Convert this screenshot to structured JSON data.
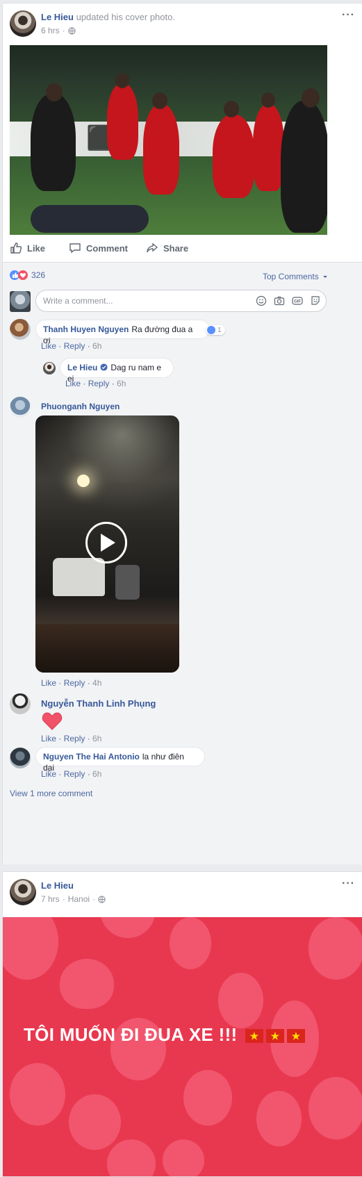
{
  "post1": {
    "author": "Le Hieu",
    "action_text": "updated his cover photo.",
    "time": "6 hrs",
    "privacy_icon": "globe-icon",
    "more_icon": "ellipsis-icon",
    "actions": {
      "like": "Like",
      "comment": "Comment",
      "share": "Share"
    },
    "reactions_count": "326",
    "sort_label": "Top Comments",
    "composer_placeholder": "Write a comment...",
    "composer_icons": [
      "emoji-icon",
      "camera-icon",
      "gif-icon",
      "sticker-icon"
    ],
    "comments": [
      {
        "author": "Thanh Huyen Nguyen",
        "text": "Ra đường đua a ơi",
        "like": "Like",
        "reply": "Reply",
        "time": "6h",
        "reaction_count": "1",
        "reply_item": {
          "author": "Le Hieu",
          "verified_icon": "verified-check-icon",
          "text": "Dag ru nam e ei",
          "like": "Like",
          "reply": "Reply",
          "time": "6h"
        }
      },
      {
        "author": "Phuonganh Nguyen",
        "like": "Like",
        "reply": "Reply",
        "time": "4h"
      },
      {
        "author": "Nguyễn Thanh Linh Phụng",
        "sticker": "heart-icon",
        "like": "Like",
        "reply": "Reply",
        "time": "6h"
      },
      {
        "author": "Nguyen The Hai Antonio",
        "text": "la như điên dại",
        "like": "Like",
        "reply": "Reply",
        "time": "6h"
      }
    ],
    "view_more": "View 1 more comment"
  },
  "post2": {
    "author": "Le Hieu",
    "time": "7 hrs",
    "location": "Hanoi",
    "banner_text": "TÔI MUỐN ĐI ĐUA XE !!!",
    "flags_count": 3,
    "banner_color": "#e8384f",
    "flag_star": "★"
  }
}
